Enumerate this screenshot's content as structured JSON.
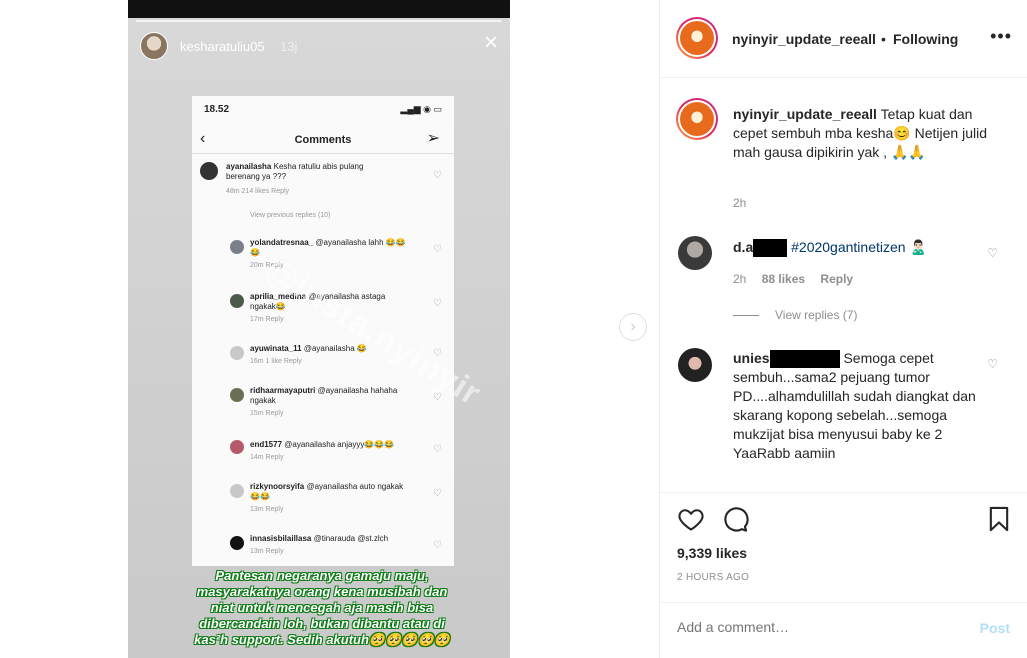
{
  "story": {
    "username": "kesharatuliu05",
    "time": "13j",
    "close_icon": "close-icon",
    "phone": {
      "status_time": "18.52",
      "title": "Comments",
      "comments": [
        {
          "user": "ayanailasha",
          "text": "Kesha ratuliu abis pulang berenang ya ???",
          "meta": "48m   214 likes   Reply"
        },
        {
          "user": "yolandatresnaa_",
          "text": "@ayanailasha lahh 😂😂😂",
          "meta": "20m   Reply"
        },
        {
          "user": "aprilia_medina",
          "text": "@ayanailasha astaga ngakak😂",
          "meta": "17m   Reply"
        },
        {
          "user": "ayuwinata_11",
          "text": "@ayanailasha 😂",
          "meta": "16m   1 like   Reply"
        },
        {
          "user": "ridhaarmayaputri",
          "text": "@ayanailasha hahaha ngakak",
          "meta": "15m   Reply"
        },
        {
          "user": "end1577",
          "text": "@ayanailasha anjayyy😂😂😂",
          "meta": "14m   Reply"
        },
        {
          "user": "rizkynoorsyifa",
          "text": "@ayanailasha auto ngakak😂😂",
          "meta": "13m   Reply"
        },
        {
          "user": "innasisbilaillasa",
          "text": "@tinarauda @st.zlch",
          "meta": "13m   Reply"
        }
      ],
      "view_previous": "View previous replies (10)"
    },
    "caption_overlay": "Pantesan negaranya gamaju maju, masyarakatnya orang kena musibah dan niat untuk mencegah aja masih bisa dibercandain loh, bukan dibantu atau di kas²h support. Sedih akutuh🥺🥺🥺🥺🥺",
    "watermark": "@insta.nyinyir"
  },
  "post": {
    "header": {
      "username": "nyinyir_update_reeall",
      "separator": "•",
      "follow_label": "Following",
      "more_icon": "more-icon"
    },
    "caption": {
      "username": "nyinyir_update_reeall",
      "text": "Tetap kuat dan cepet sembuh mba kesha😊 Netijen julid mah gausa dipikirin yak , 🙏🙏",
      "time": "2h"
    },
    "comments": [
      {
        "user_prefix": "d.a",
        "text": "#2020gantinetizen 🙎🏻‍♂️",
        "time": "2h",
        "likes": "88 likes",
        "reply": "Reply",
        "view_replies": "View replies (7)"
      },
      {
        "user_prefix": "unies",
        "text": "Semoga cepet sembuh...sama2 pejuang tumor PD....alhamdulillah sudah diangkat dan skarang kopong sebelah...semoga mukzijat bisa menyusui baby ke 2 YaaRabb aamiin"
      }
    ],
    "likes": "9,339 likes",
    "time_ago": "2 HOURS AGO",
    "add_comment_placeholder": "Add a comment…",
    "post_label": "Post"
  },
  "colors": {
    "link": "#00376b",
    "muted": "#8e8e8e",
    "post_button_disabled": "#b2dffc"
  }
}
